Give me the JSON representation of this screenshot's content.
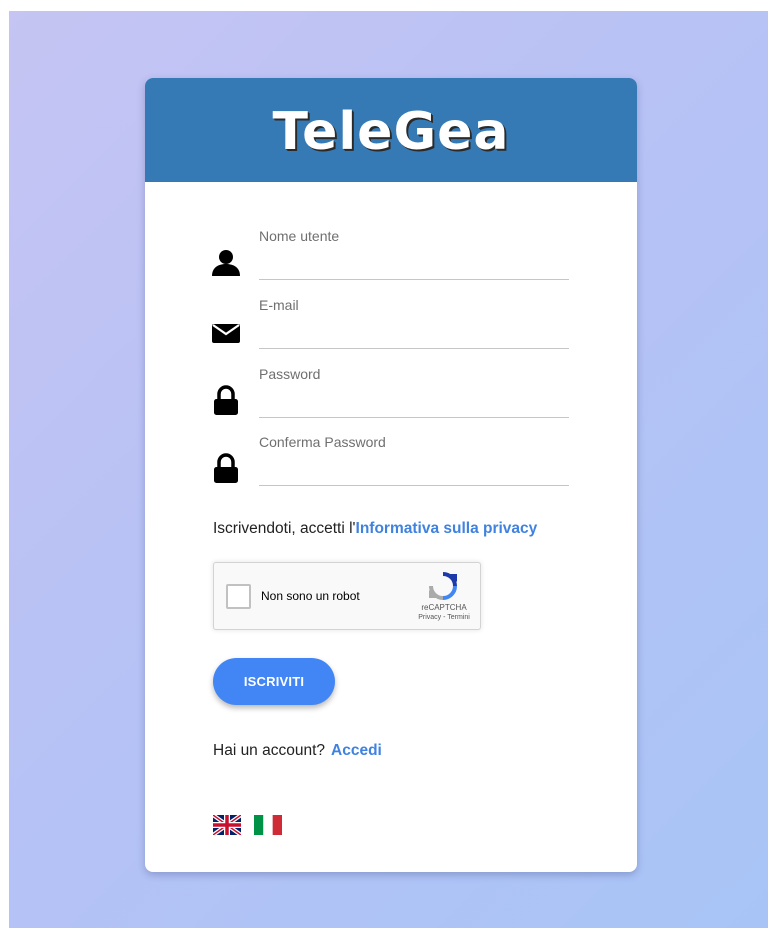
{
  "brand": {
    "logo_text": "TeleGea",
    "header_color": "#357ab5"
  },
  "form": {
    "fields": [
      {
        "label": "Nome utente",
        "icon": "user-icon",
        "value": ""
      },
      {
        "label": "E-mail",
        "icon": "envelope-icon",
        "value": ""
      },
      {
        "label": "Password",
        "icon": "lock-icon",
        "value": ""
      },
      {
        "label": "Conferma Password",
        "icon": "lock-icon",
        "value": ""
      }
    ],
    "privacy": {
      "prefix": "Iscrivendoti, accetti l'",
      "link": "Informativa sulla privacy"
    },
    "recaptcha": {
      "label": "Non sono un robot",
      "brand": "reCAPTCHA",
      "links": "Privacy - Termini"
    },
    "submit_label": "ISCRIVITI",
    "account": {
      "prompt": "Hai un account?",
      "link": "Accedi"
    }
  },
  "languages": [
    {
      "code": "en",
      "icon": "uk-flag-icon"
    },
    {
      "code": "it",
      "icon": "italy-flag-icon"
    }
  ],
  "colors": {
    "accent": "#4285f4",
    "link": "#3f82e0"
  }
}
